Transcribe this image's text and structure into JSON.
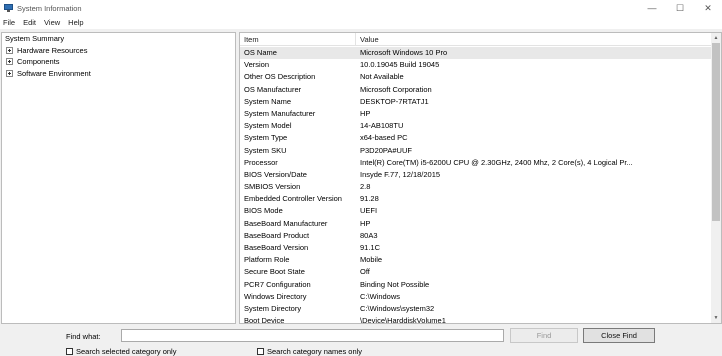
{
  "window": {
    "title": "System Information",
    "controls": {
      "minimize": "—",
      "maximize": "☐",
      "close": "✕"
    }
  },
  "menu": [
    "File",
    "Edit",
    "View",
    "Help"
  ],
  "tree": {
    "root": "System Summary",
    "children": [
      "Hardware Resources",
      "Components",
      "Software Environment"
    ]
  },
  "list": {
    "headers": {
      "item": "Item",
      "value": "Value"
    },
    "rows": [
      {
        "item": "OS Name",
        "value": "Microsoft Windows 10 Pro"
      },
      {
        "item": "Version",
        "value": "10.0.19045 Build 19045"
      },
      {
        "item": "Other OS Description",
        "value": "Not Available"
      },
      {
        "item": "OS Manufacturer",
        "value": "Microsoft Corporation"
      },
      {
        "item": "System Name",
        "value": "DESKTOP-7RTATJ1"
      },
      {
        "item": "System Manufacturer",
        "value": "HP"
      },
      {
        "item": "System Model",
        "value": "14-AB108TU"
      },
      {
        "item": "System Type",
        "value": "x64-based PC"
      },
      {
        "item": "System SKU",
        "value": "P3D20PA#UUF"
      },
      {
        "item": "Processor",
        "value": "Intel(R) Core(TM) i5-6200U CPU @ 2.30GHz, 2400 Mhz, 2 Core(s), 4 Logical Pr..."
      },
      {
        "item": "BIOS Version/Date",
        "value": "Insyde F.77, 12/18/2015"
      },
      {
        "item": "SMBIOS Version",
        "value": "2.8"
      },
      {
        "item": "Embedded Controller Version",
        "value": "91.28"
      },
      {
        "item": "BIOS Mode",
        "value": "UEFI"
      },
      {
        "item": "BaseBoard Manufacturer",
        "value": "HP"
      },
      {
        "item": "BaseBoard Product",
        "value": "80A3"
      },
      {
        "item": "BaseBoard Version",
        "value": "91.1C"
      },
      {
        "item": "Platform Role",
        "value": "Mobile"
      },
      {
        "item": "Secure Boot State",
        "value": "Off"
      },
      {
        "item": "PCR7 Configuration",
        "value": "Binding Not Possible"
      },
      {
        "item": "Windows Directory",
        "value": "C:\\Windows"
      },
      {
        "item": "System Directory",
        "value": "C:\\Windows\\system32"
      },
      {
        "item": "Boot Device",
        "value": "\\Device\\HarddiskVolume1"
      }
    ],
    "selected_row": "OS Name"
  },
  "findbar": {
    "label": "Find what:",
    "value": "",
    "find_button": "Find",
    "close_button": "Close Find",
    "check_selected": "Search selected category only",
    "check_names": "Search category names only"
  },
  "icons": {
    "app": "system-information-icon",
    "expand": "plus-expander-icon",
    "scroll_up": "chevron-up-icon",
    "scroll_down": "chevron-down-icon"
  }
}
